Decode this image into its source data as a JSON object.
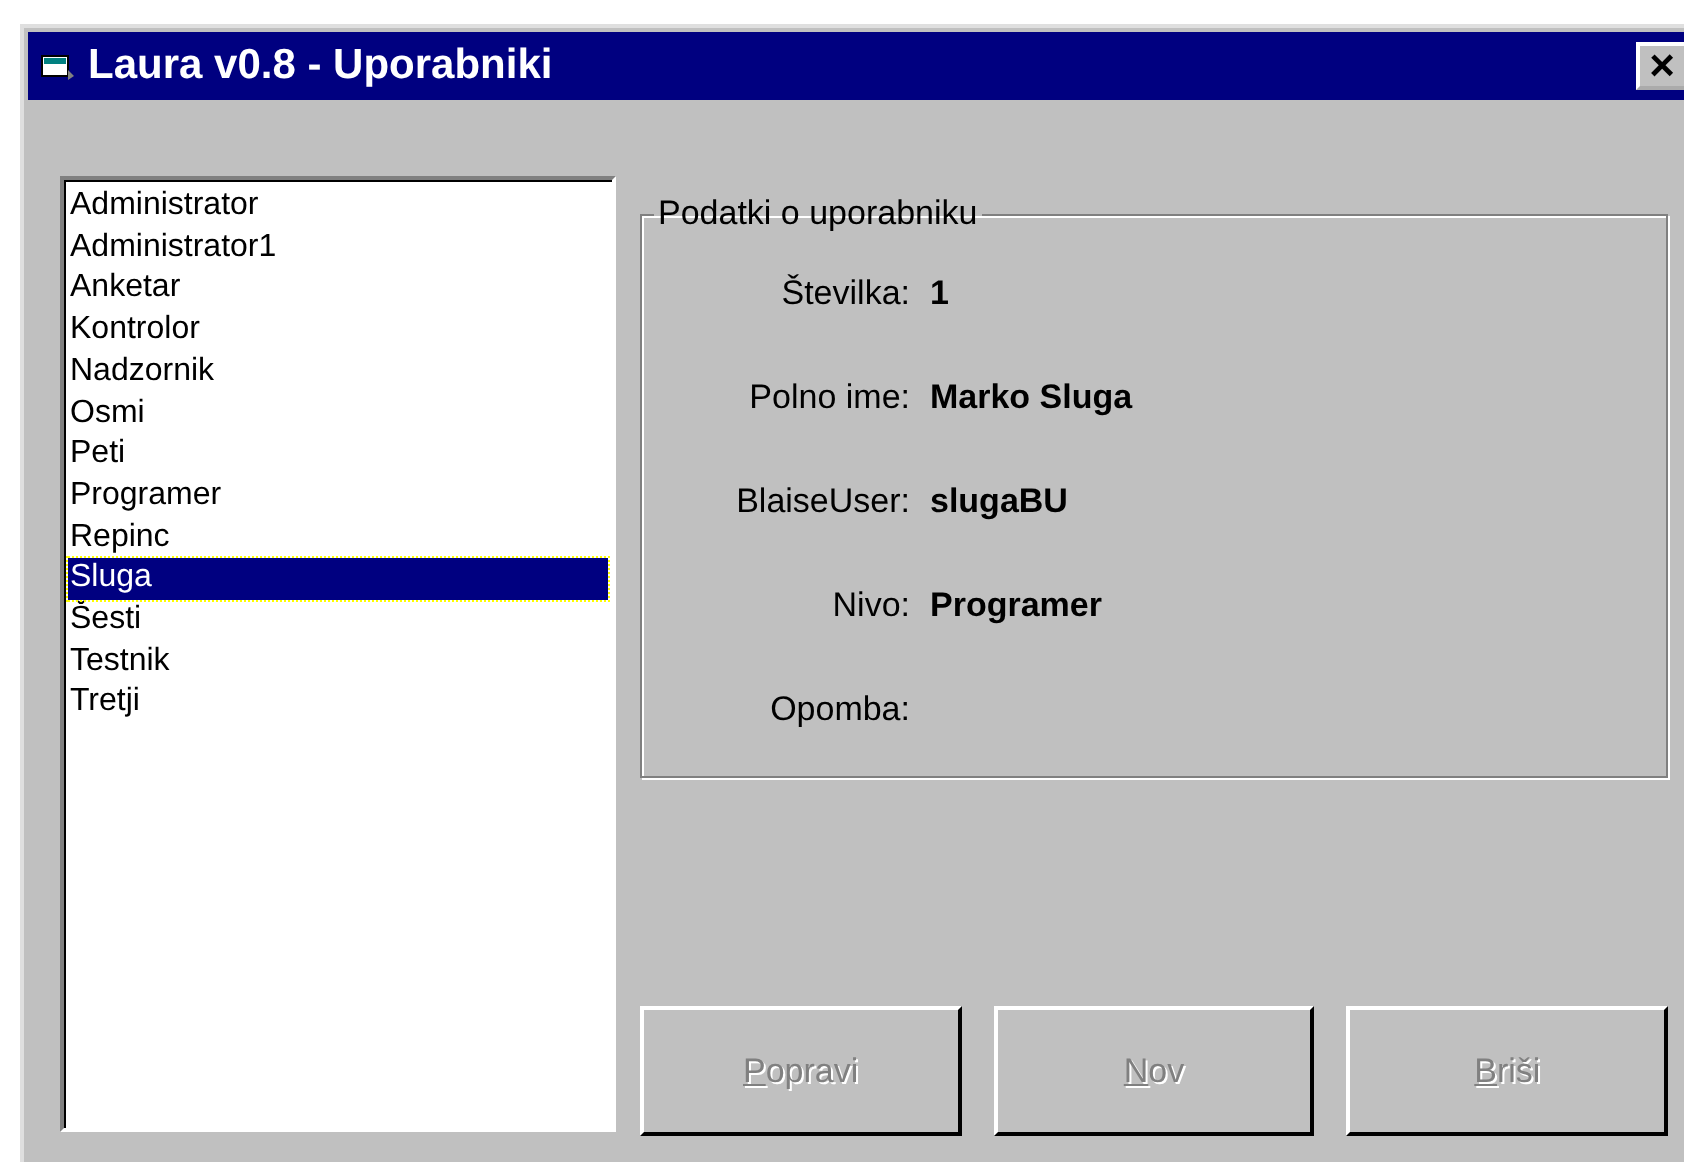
{
  "window": {
    "title": "Laura v0.8 - Uporabniki",
    "close": "×"
  },
  "users": [
    {
      "name": "Administrator",
      "selected": false
    },
    {
      "name": "Administrator1",
      "selected": false
    },
    {
      "name": "Anketar",
      "selected": false
    },
    {
      "name": "Kontrolor",
      "selected": false
    },
    {
      "name": "Nadzornik",
      "selected": false
    },
    {
      "name": "Osmi",
      "selected": false
    },
    {
      "name": "Peti",
      "selected": false
    },
    {
      "name": "Programer",
      "selected": false
    },
    {
      "name": "Repinc",
      "selected": false
    },
    {
      "name": "Sluga",
      "selected": true
    },
    {
      "name": "Šesti",
      "selected": false
    },
    {
      "name": "Testnik",
      "selected": false
    },
    {
      "name": "Tretji",
      "selected": false
    }
  ],
  "details": {
    "title": "Podatki o uporabniku",
    "fields": [
      {
        "label": "Številka:",
        "value": "1"
      },
      {
        "label": "Polno ime:",
        "value": "Marko Sluga"
      },
      {
        "label": "BlaiseUser:",
        "value": "slugaBU"
      },
      {
        "label": "Nivo:",
        "value": "Programer"
      },
      {
        "label": "Opomba:"
      }
    ]
  },
  "buttons": [
    {
      "label": "Popravi",
      "disabled": true
    },
    {
      "label": "Nov",
      "disabled": true
    },
    {
      "label": "Briši",
      "disabled": true
    }
  ]
}
